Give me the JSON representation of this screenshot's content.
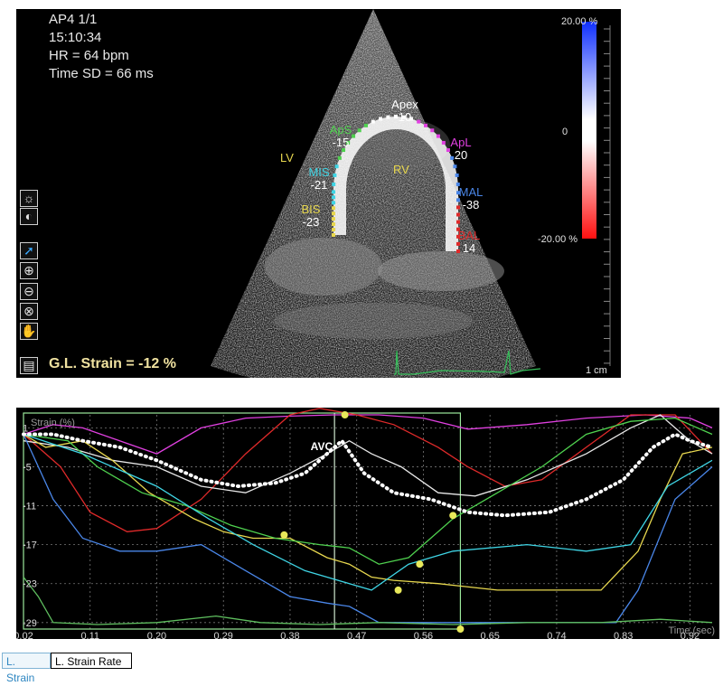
{
  "header": {
    "view": "AP4 1/1",
    "time": "15:10:34",
    "hr": "HR = 64 bpm",
    "time_sd": "Time SD = 66 ms"
  },
  "image": {
    "chamber_labels": [
      "LV",
      "RV"
    ],
    "segments": [
      {
        "name": "Apex",
        "value": "10",
        "color": "#ffffff"
      },
      {
        "name": "ApS",
        "value": "-15",
        "color": "#4fd14f"
      },
      {
        "name": "ApL",
        "value": "20",
        "color": "#e040e0"
      },
      {
        "name": "MIS",
        "value": "-21",
        "color": "#3fd5e5"
      },
      {
        "name": "MAL",
        "value": "-38",
        "color": "#4a86e8"
      },
      {
        "name": "BIS",
        "value": "-23",
        "color": "#e8d84f"
      },
      {
        "name": "BAL",
        "value": "14",
        "color": "#e02a2a"
      }
    ],
    "global_strain": "G.L. Strain = -12 %",
    "scale_unit": "1 cm"
  },
  "colorbar": {
    "top": "20.00 %",
    "mid": "0",
    "bottom": "-20.00 %"
  },
  "toolbar": {
    "tools": [
      {
        "name": "brightness",
        "glyph": "☼",
        "selected": false
      },
      {
        "name": "contrast",
        "glyph": "◐",
        "selected": false
      },
      {
        "name": "select",
        "glyph": "➚",
        "selected": true
      },
      {
        "name": "zoom-in",
        "glyph": "⊕",
        "selected": false
      },
      {
        "name": "zoom-out",
        "glyph": "⊖",
        "selected": false
      },
      {
        "name": "reset",
        "glyph": "⊗",
        "selected": false
      },
      {
        "name": "pan",
        "glyph": "✋",
        "selected": false
      }
    ]
  },
  "chart_data": {
    "type": "line",
    "ylabel": "Strain (%)",
    "xlabel": "Time (sec)",
    "xlim": [
      0.02,
      0.95
    ],
    "ylim": [
      -30,
      3
    ],
    "x_ticks": [
      "0.02",
      "0.11",
      "0.20",
      "0.29",
      "0.38",
      "0.47",
      "0.56",
      "0.65",
      "0.74",
      "0.83",
      "0.92"
    ],
    "y_ticks": [
      "1",
      "-5",
      "-11",
      "-17",
      "-23",
      "-29"
    ],
    "annotation": {
      "label": "AVC",
      "x": 0.44
    },
    "avc_window": [
      0.02,
      0.61
    ],
    "series": [
      {
        "color": "#e040e0",
        "points": [
          [
            0.02,
            0
          ],
          [
            0.06,
            1.5
          ],
          [
            0.1,
            1
          ],
          [
            0.15,
            -1
          ],
          [
            0.2,
            -3
          ],
          [
            0.26,
            1
          ],
          [
            0.32,
            2.5
          ],
          [
            0.38,
            2.8
          ],
          [
            0.44,
            3
          ],
          [
            0.5,
            3
          ],
          [
            0.56,
            2.5
          ],
          [
            0.62,
            0.8
          ],
          [
            0.7,
            1.5
          ],
          [
            0.78,
            2.5
          ],
          [
            0.86,
            3
          ],
          [
            0.92,
            2.5
          ],
          [
            0.95,
            1
          ]
        ]
      },
      {
        "color": "#e02a2a",
        "points": [
          [
            0.02,
            0
          ],
          [
            0.07,
            -5
          ],
          [
            0.11,
            -12
          ],
          [
            0.16,
            -15
          ],
          [
            0.2,
            -14.5
          ],
          [
            0.26,
            -10
          ],
          [
            0.32,
            -3
          ],
          [
            0.38,
            3
          ],
          [
            0.42,
            4
          ],
          [
            0.47,
            3
          ],
          [
            0.52,
            1.5
          ],
          [
            0.58,
            -2
          ],
          [
            0.62,
            -5
          ],
          [
            0.67,
            -8
          ],
          [
            0.72,
            -7
          ],
          [
            0.78,
            -2
          ],
          [
            0.84,
            3
          ],
          [
            0.9,
            3
          ],
          [
            0.95,
            -3
          ]
        ]
      },
      {
        "color": "#e8e8e8",
        "points": [
          [
            0.02,
            -1
          ],
          [
            0.08,
            -2
          ],
          [
            0.14,
            -4
          ],
          [
            0.2,
            -5
          ],
          [
            0.26,
            -8
          ],
          [
            0.32,
            -9
          ],
          [
            0.38,
            -6
          ],
          [
            0.43,
            -3
          ],
          [
            0.46,
            -1
          ],
          [
            0.49,
            -3
          ],
          [
            0.53,
            -5
          ],
          [
            0.58,
            -9
          ],
          [
            0.63,
            -9.5
          ],
          [
            0.7,
            -7
          ],
          [
            0.78,
            -3
          ],
          [
            0.84,
            1
          ],
          [
            0.88,
            3
          ],
          [
            0.92,
            -1
          ],
          [
            0.95,
            -3
          ]
        ]
      },
      {
        "color": "#e8d84f",
        "points": [
          [
            0.02,
            0
          ],
          [
            0.05,
            -2
          ],
          [
            0.1,
            -1
          ],
          [
            0.14,
            -4
          ],
          [
            0.19,
            -9
          ],
          [
            0.25,
            -13
          ],
          [
            0.29,
            -15
          ],
          [
            0.33,
            -16
          ],
          [
            0.38,
            -16
          ],
          [
            0.43,
            -19
          ],
          [
            0.46,
            -20
          ],
          [
            0.49,
            -22
          ],
          [
            0.52,
            -22.5
          ],
          [
            0.58,
            -23
          ],
          [
            0.66,
            -24
          ],
          [
            0.75,
            -24
          ],
          [
            0.8,
            -24
          ],
          [
            0.85,
            -18
          ],
          [
            0.88,
            -10
          ],
          [
            0.91,
            -3
          ],
          [
            0.95,
            -2
          ]
        ]
      },
      {
        "color": "#4fd14f",
        "points": [
          [
            0.02,
            0
          ],
          [
            0.08,
            -1
          ],
          [
            0.12,
            -5
          ],
          [
            0.18,
            -9
          ],
          [
            0.24,
            -11
          ],
          [
            0.3,
            -14
          ],
          [
            0.36,
            -16
          ],
          [
            0.42,
            -17
          ],
          [
            0.46,
            -17.5
          ],
          [
            0.5,
            -20
          ],
          [
            0.54,
            -19
          ],
          [
            0.6,
            -13
          ],
          [
            0.66,
            -9
          ],
          [
            0.72,
            -5
          ],
          [
            0.78,
            0
          ],
          [
            0.84,
            2
          ],
          [
            0.9,
            2.5
          ],
          [
            0.95,
            0
          ]
        ]
      },
      {
        "color": "#4a86e8",
        "points": [
          [
            0.02,
            0
          ],
          [
            0.06,
            -10
          ],
          [
            0.1,
            -16
          ],
          [
            0.15,
            -18
          ],
          [
            0.2,
            -18
          ],
          [
            0.26,
            -17
          ],
          [
            0.32,
            -21
          ],
          [
            0.38,
            -25
          ],
          [
            0.43,
            -26
          ],
          [
            0.46,
            -26.5
          ],
          [
            0.5,
            -29
          ],
          [
            0.6,
            -29
          ],
          [
            0.7,
            -29
          ],
          [
            0.82,
            -29
          ],
          [
            0.85,
            -24
          ],
          [
            0.9,
            -10
          ],
          [
            0.95,
            -5
          ]
        ]
      },
      {
        "color": "#3fd5e5",
        "points": [
          [
            0.02,
            0
          ],
          [
            0.1,
            -3
          ],
          [
            0.2,
            -8
          ],
          [
            0.27,
            -13
          ],
          [
            0.33,
            -17
          ],
          [
            0.4,
            -21
          ],
          [
            0.46,
            -23
          ],
          [
            0.49,
            -24
          ],
          [
            0.54,
            -20
          ],
          [
            0.6,
            -18
          ],
          [
            0.7,
            -17
          ],
          [
            0.78,
            -18
          ],
          [
            0.84,
            -17
          ],
          [
            0.89,
            -8
          ],
          [
            0.95,
            -4
          ]
        ]
      },
      {
        "color": "#5fbf5f",
        "points": [
          [
            0.02,
            -22
          ],
          [
            0.04,
            -25
          ],
          [
            0.06,
            -29
          ],
          [
            0.12,
            -29.3
          ],
          [
            0.2,
            -29
          ],
          [
            0.28,
            -28
          ],
          [
            0.34,
            -29
          ],
          [
            0.42,
            -29.3
          ],
          [
            0.5,
            -29
          ],
          [
            0.6,
            -29.3
          ],
          [
            0.7,
            -29
          ],
          [
            0.8,
            -29
          ],
          [
            0.88,
            -28.5
          ],
          [
            0.95,
            -29
          ]
        ]
      }
    ],
    "average": {
      "color": "#ffffff",
      "points": [
        [
          0.02,
          0
        ],
        [
          0.06,
          0
        ],
        [
          0.1,
          -1
        ],
        [
          0.15,
          -2
        ],
        [
          0.2,
          -4
        ],
        [
          0.26,
          -7
        ],
        [
          0.31,
          -8
        ],
        [
          0.36,
          -7.5
        ],
        [
          0.4,
          -6
        ],
        [
          0.43,
          -3
        ],
        [
          0.45,
          -1
        ],
        [
          0.48,
          -6
        ],
        [
          0.52,
          -9
        ],
        [
          0.57,
          -10
        ],
        [
          0.62,
          -12
        ],
        [
          0.67,
          -12.5
        ],
        [
          0.73,
          -12
        ],
        [
          0.78,
          -10
        ],
        [
          0.83,
          -7
        ],
        [
          0.87,
          -2
        ],
        [
          0.9,
          0
        ],
        [
          0.92,
          -1
        ],
        [
          0.95,
          -2
        ]
      ]
    },
    "markers": [
      {
        "x": 0.372,
        "y": -15.5
      },
      {
        "x": 0.454,
        "y": 3
      },
      {
        "x": 0.526,
        "y": -24
      },
      {
        "x": 0.555,
        "y": -20
      },
      {
        "x": 0.6,
        "y": -12.5
      },
      {
        "x": 0.61,
        "y": -30
      }
    ],
    "marker_color": "#e8e85a"
  },
  "tabs": {
    "strain": "L. Strain",
    "rate": "L. Strain Rate"
  }
}
